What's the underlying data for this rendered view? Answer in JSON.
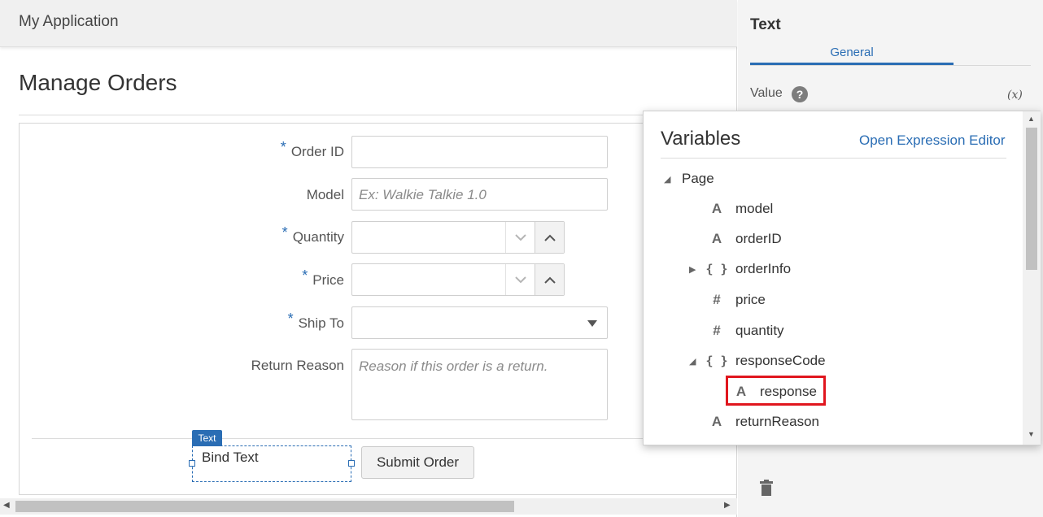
{
  "app": {
    "title": "My Application"
  },
  "page": {
    "title": "Manage Orders"
  },
  "form": {
    "order_id": {
      "label": "Order ID",
      "required": "*",
      "value": ""
    },
    "model": {
      "label": "Model",
      "placeholder": "Ex: Walkie Talkie 1.0"
    },
    "quantity": {
      "label": "Quantity",
      "required": "*"
    },
    "price": {
      "label": "Price",
      "required": "*"
    },
    "ship_to": {
      "label": "Ship To",
      "required": "*"
    },
    "return_reason": {
      "label": "Return Reason",
      "placeholder": "Reason if this order is a return."
    },
    "bind_text": "Bind Text",
    "text_tag": "Text",
    "submit_label": "Submit Order"
  },
  "properties": {
    "title": "Text",
    "tab_general": "General",
    "value_label": "Value",
    "help_glyph": "?",
    "expr_glyph": "(x)"
  },
  "variables": {
    "title": "Variables",
    "open_expression_editor": "Open Expression Editor",
    "tree": [
      {
        "name": "Page",
        "type": "folder",
        "expanded": true
      },
      {
        "name": "model",
        "type": "string",
        "icon": "A"
      },
      {
        "name": "orderID",
        "type": "string",
        "icon": "A"
      },
      {
        "name": "orderInfo",
        "type": "object",
        "icon": "{ }",
        "expanded": false
      },
      {
        "name": "price",
        "type": "number",
        "icon": "#"
      },
      {
        "name": "quantity",
        "type": "number",
        "icon": "#"
      },
      {
        "name": "responseCode",
        "type": "object",
        "icon": "{ }",
        "expanded": true
      },
      {
        "name": "response",
        "type": "string",
        "icon": "A",
        "highlighted": true
      },
      {
        "name": "returnReason",
        "type": "string",
        "icon": "A"
      }
    ]
  },
  "colors": {
    "accent": "#2a6db4",
    "highlight": "#e0161e"
  }
}
